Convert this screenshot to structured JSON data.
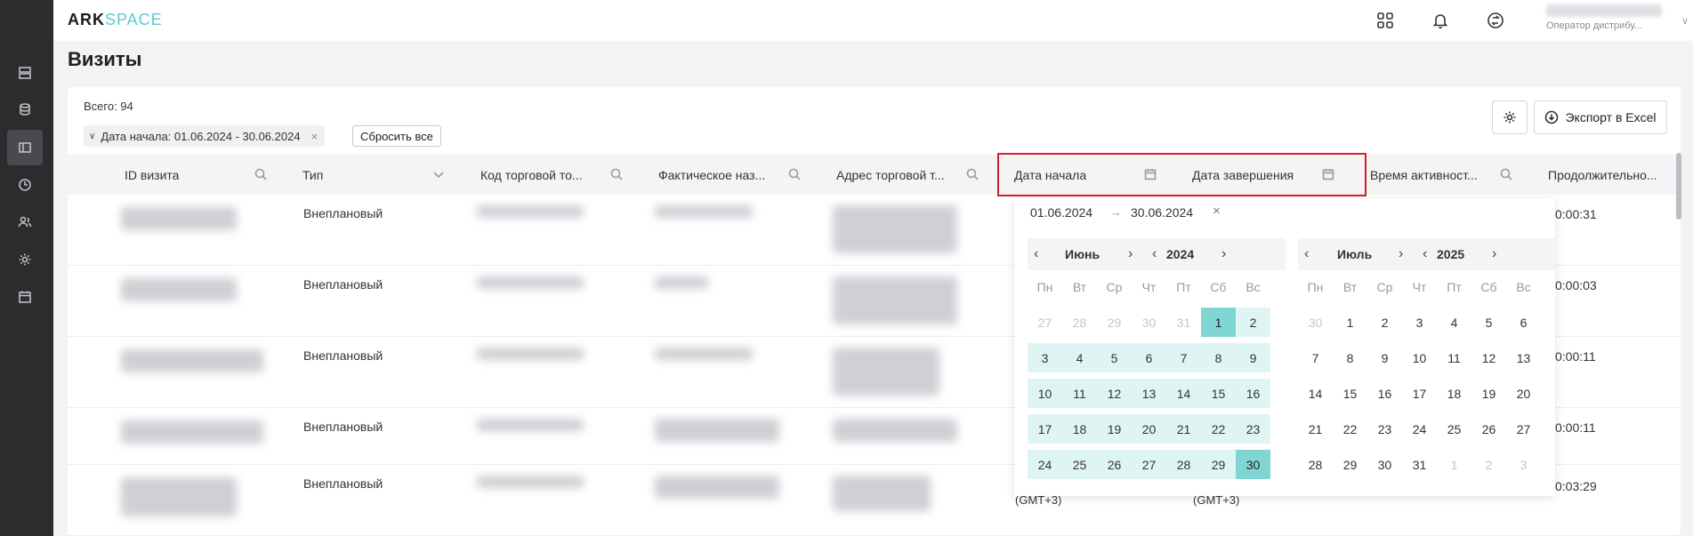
{
  "app": {
    "logo_main": "ARK",
    "logo_accent": "SPACE",
    "user_role": "Оператор дистрибу..."
  },
  "page": {
    "title": "Визиты"
  },
  "toolbar": {
    "total": "Всего: 94",
    "filter_chip": "Дата начала: 01.06.2024 - 30.06.2024",
    "reset_all": "Сбросить все",
    "export": "Экспорт в Excel"
  },
  "columns": [
    "ID визита",
    "Тип",
    "Код торговой то...",
    "Фактическое наз...",
    "Адрес торговой т...",
    "Дата начала",
    "Дата завершения",
    "Время активност...",
    "Продолжительно..."
  ],
  "rows": [
    {
      "type": "Внеплановый",
      "duration": "0:00:31"
    },
    {
      "type": "Внеплановый",
      "duration": "0:00:03"
    },
    {
      "type": "Внеплановый",
      "duration": "0:00:11"
    },
    {
      "type": "Внеплановый",
      "duration": "0:00:11"
    },
    {
      "type": "Внеплановый",
      "duration": "0:03:29"
    }
  ],
  "row_gmt": "(GMT+3)",
  "datepicker": {
    "start": "01.06.2024",
    "end": "30.06.2024",
    "arrow": "→",
    "clear": "×",
    "weekdays": [
      "Пн",
      "Вт",
      "Ср",
      "Чт",
      "Пт",
      "Сб",
      "Вс"
    ],
    "left": {
      "month": "Июнь",
      "year": "2024",
      "days": [
        {
          "d": "27",
          "s": "muted"
        },
        {
          "d": "28",
          "s": "muted"
        },
        {
          "d": "29",
          "s": "muted"
        },
        {
          "d": "30",
          "s": "muted"
        },
        {
          "d": "31",
          "s": "muted"
        },
        {
          "d": "1",
          "s": "edge"
        },
        {
          "d": "2",
          "s": "inrange"
        },
        {
          "d": "3",
          "s": "inrange"
        },
        {
          "d": "4",
          "s": "inrange"
        },
        {
          "d": "5",
          "s": "inrange"
        },
        {
          "d": "6",
          "s": "inrange"
        },
        {
          "d": "7",
          "s": "inrange"
        },
        {
          "d": "8",
          "s": "inrange"
        },
        {
          "d": "9",
          "s": "inrange"
        },
        {
          "d": "10",
          "s": "inrange"
        },
        {
          "d": "11",
          "s": "inrange"
        },
        {
          "d": "12",
          "s": "inrange"
        },
        {
          "d": "13",
          "s": "inrange"
        },
        {
          "d": "14",
          "s": "inrange"
        },
        {
          "d": "15",
          "s": "inrange"
        },
        {
          "d": "16",
          "s": "inrange"
        },
        {
          "d": "17",
          "s": "inrange"
        },
        {
          "d": "18",
          "s": "inrange"
        },
        {
          "d": "19",
          "s": "inrange"
        },
        {
          "d": "20",
          "s": "inrange"
        },
        {
          "d": "21",
          "s": "inrange"
        },
        {
          "d": "22",
          "s": "inrange"
        },
        {
          "d": "23",
          "s": "inrange"
        },
        {
          "d": "24",
          "s": "inrange"
        },
        {
          "d": "25",
          "s": "inrange"
        },
        {
          "d": "26",
          "s": "inrange"
        },
        {
          "d": "27",
          "s": "inrange"
        },
        {
          "d": "28",
          "s": "inrange"
        },
        {
          "d": "29",
          "s": "inrange"
        },
        {
          "d": "30",
          "s": "edge"
        }
      ]
    },
    "right": {
      "month": "Июль",
      "year": "2025",
      "days": [
        {
          "d": "30",
          "s": "muted"
        },
        {
          "d": "1",
          "s": ""
        },
        {
          "d": "2",
          "s": ""
        },
        {
          "d": "3",
          "s": ""
        },
        {
          "d": "4",
          "s": ""
        },
        {
          "d": "5",
          "s": ""
        },
        {
          "d": "6",
          "s": ""
        },
        {
          "d": "7",
          "s": ""
        },
        {
          "d": "8",
          "s": ""
        },
        {
          "d": "9",
          "s": ""
        },
        {
          "d": "10",
          "s": ""
        },
        {
          "d": "11",
          "s": ""
        },
        {
          "d": "12",
          "s": ""
        },
        {
          "d": "13",
          "s": ""
        },
        {
          "d": "14",
          "s": ""
        },
        {
          "d": "15",
          "s": ""
        },
        {
          "d": "16",
          "s": ""
        },
        {
          "d": "17",
          "s": ""
        },
        {
          "d": "18",
          "s": ""
        },
        {
          "d": "19",
          "s": ""
        },
        {
          "d": "20",
          "s": ""
        },
        {
          "d": "21",
          "s": ""
        },
        {
          "d": "22",
          "s": ""
        },
        {
          "d": "23",
          "s": ""
        },
        {
          "d": "24",
          "s": ""
        },
        {
          "d": "25",
          "s": ""
        },
        {
          "d": "26",
          "s": ""
        },
        {
          "d": "27",
          "s": ""
        },
        {
          "d": "28",
          "s": ""
        },
        {
          "d": "29",
          "s": ""
        },
        {
          "d": "30",
          "s": ""
        },
        {
          "d": "31",
          "s": ""
        },
        {
          "d": "1",
          "s": "muted"
        },
        {
          "d": "2",
          "s": "muted"
        },
        {
          "d": "3",
          "s": "muted"
        }
      ]
    }
  },
  "colors": {
    "accent": "#5ccad1",
    "range_edge": "#7fd6d3",
    "range_fill": "#dff5f4",
    "highlight": "#d21f2b",
    "sidebar": "#2c2c2e"
  }
}
